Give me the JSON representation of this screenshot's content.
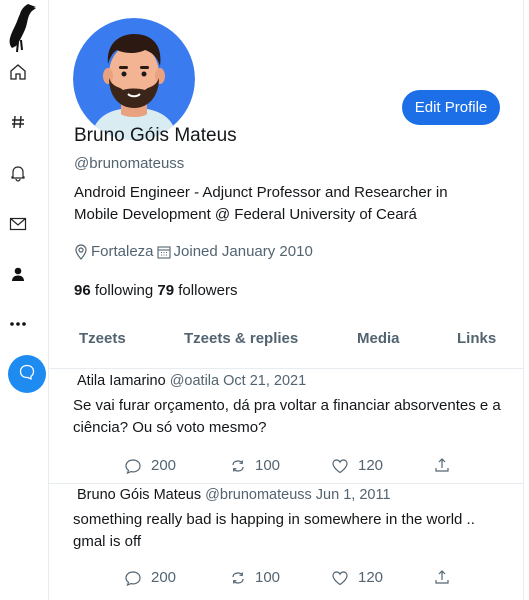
{
  "profile": {
    "name": "Bruno Góis Mateus",
    "handle": "@brunomateuss",
    "bio": "Android Engineer - Adjunct Professor and Researcher in Mobile Development @ Federal University of Ceará",
    "location": "Fortaleza",
    "joined": "Joined January 2010",
    "following_count": "96",
    "following_label": "following",
    "followers_count": "79",
    "followers_label": "followers",
    "edit_label": "Edit Profile"
  },
  "tabs": [
    "Tzeets",
    "Tzeets & replies",
    "Media",
    "Links"
  ],
  "tweets": [
    {
      "author": "Atila Iamarino",
      "handle": "@oatila",
      "date": "Oct 21, 2021",
      "text": "Se vai furar orçamento, dá pra voltar a financiar absorventes e a ciência? Ou só voto mesmo?",
      "replies": "200",
      "retweets": "100",
      "likes": "120"
    },
    {
      "author": "Bruno Góis Mateus",
      "handle": "@brunomateuss",
      "date": "Jun 1, 2011",
      "text": "something really bad is happing in somewhere in the world .. gmal is off",
      "replies": "200",
      "retweets": "100",
      "likes": "120"
    }
  ],
  "colors": {
    "accent": "#1d6fe8",
    "compose": "#1d8bf0",
    "muted": "#536471",
    "avatar_bg": "#3a7bf0"
  },
  "icons": [
    "raven-logo-icon",
    "home-icon",
    "hashtag-icon",
    "bell-icon",
    "mail-icon",
    "user-icon",
    "more-icon",
    "compose-icon",
    "location-pin-icon",
    "calendar-icon",
    "reply-icon",
    "retweet-icon",
    "like-icon",
    "share-icon"
  ]
}
